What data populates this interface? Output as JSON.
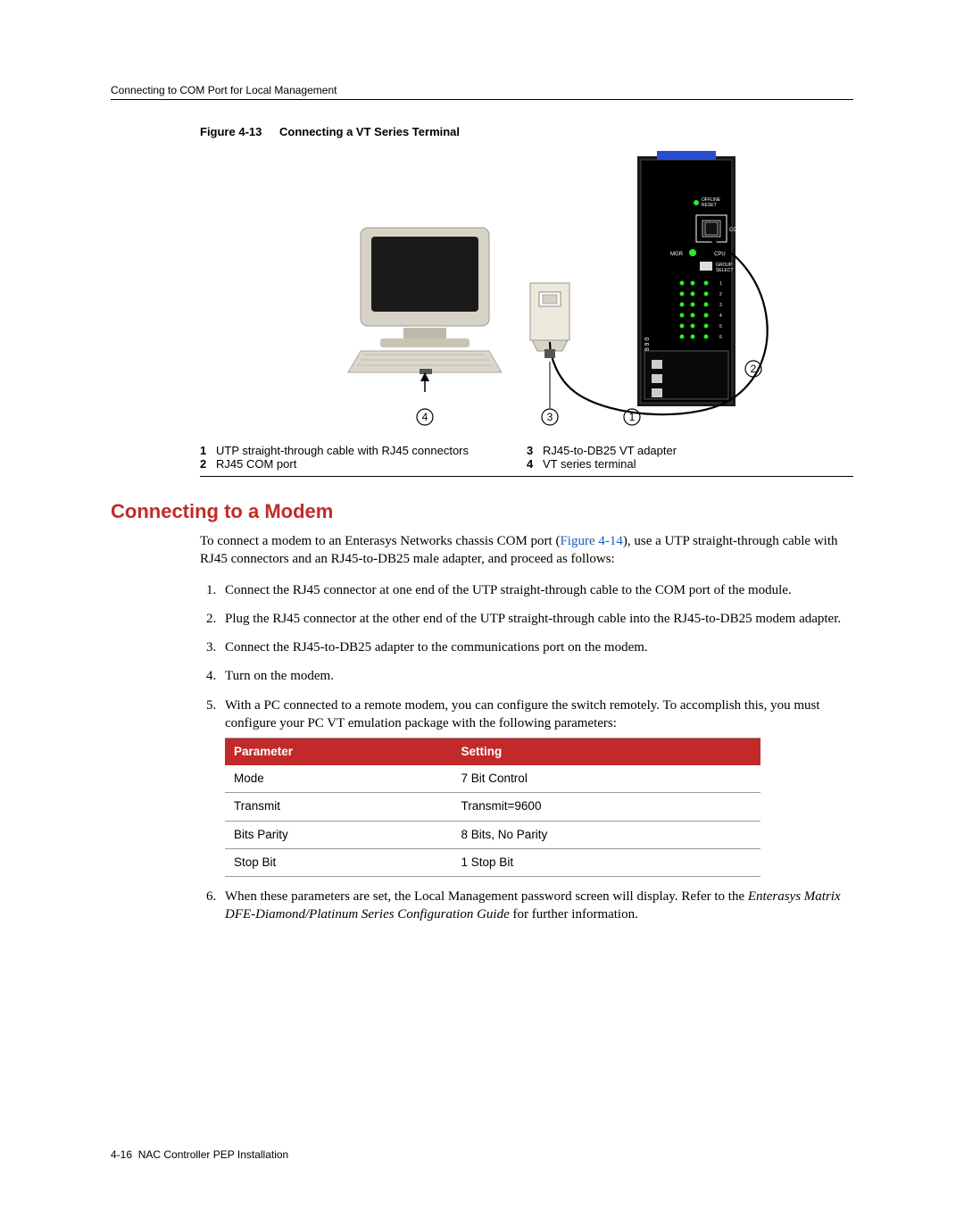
{
  "header": {
    "running": "Connecting to COM Port for Local Management"
  },
  "figure": {
    "label": "Figure 4-13",
    "title": "Connecting a VT Series Terminal",
    "legend": [
      {
        "n": "1",
        "text": "UTP straight-through cable with RJ45 connectors"
      },
      {
        "n": "2",
        "text": "RJ45 COM port"
      },
      {
        "n": "3",
        "text": "RJ45-to-DB25 VT adapter"
      },
      {
        "n": "4",
        "text": "VT series terminal"
      }
    ],
    "device_labels": {
      "offline": "OFFLINE",
      "reset": "RESET",
      "com": "COM",
      "mgr": "MGR",
      "cpu": "CPU",
      "group": "GROUP",
      "select": "SELECT"
    }
  },
  "section": {
    "heading": "Connecting to a Modem",
    "intro_pre": "To connect a modem to an Enterasys Networks chassis COM port (",
    "intro_link": "Figure 4-14",
    "intro_post": "), use a UTP straight-through cable with RJ45 connectors and an RJ45-to-DB25 male adapter, and proceed as follows:",
    "steps": [
      "Connect the RJ45 connector at one end of the UTP straight-through cable to the COM port of the module.",
      "Plug the RJ45 connector at the other end of the UTP straight-through cable into the RJ45-to-DB25 modem adapter.",
      "Connect the RJ45-to-DB25 adapter to the communications port on the modem.",
      "Turn on the modem.",
      "With a PC connected to a remote modem, you can configure the switch remotely. To accomplish this, you must configure your PC VT emulation package with the following parameters:"
    ],
    "table": {
      "headers": [
        "Parameter",
        "Setting"
      ],
      "rows": [
        [
          "Mode",
          "7 Bit Control"
        ],
        [
          "Transmit",
          "Transmit=9600"
        ],
        [
          "Bits Parity",
          "8 Bits, No Parity"
        ],
        [
          "Stop Bit",
          "1 Stop Bit"
        ]
      ]
    },
    "step6_pre": "When these parameters are set, the Local Management password screen will display. Refer to the ",
    "step6_em": "Enterasys Matrix DFE-Diamond/Platinum Series Configuration Guide",
    "step6_post": " for further information."
  },
  "footer": {
    "pageref": "4-16",
    "title": "NAC Controller PEP Installation"
  }
}
